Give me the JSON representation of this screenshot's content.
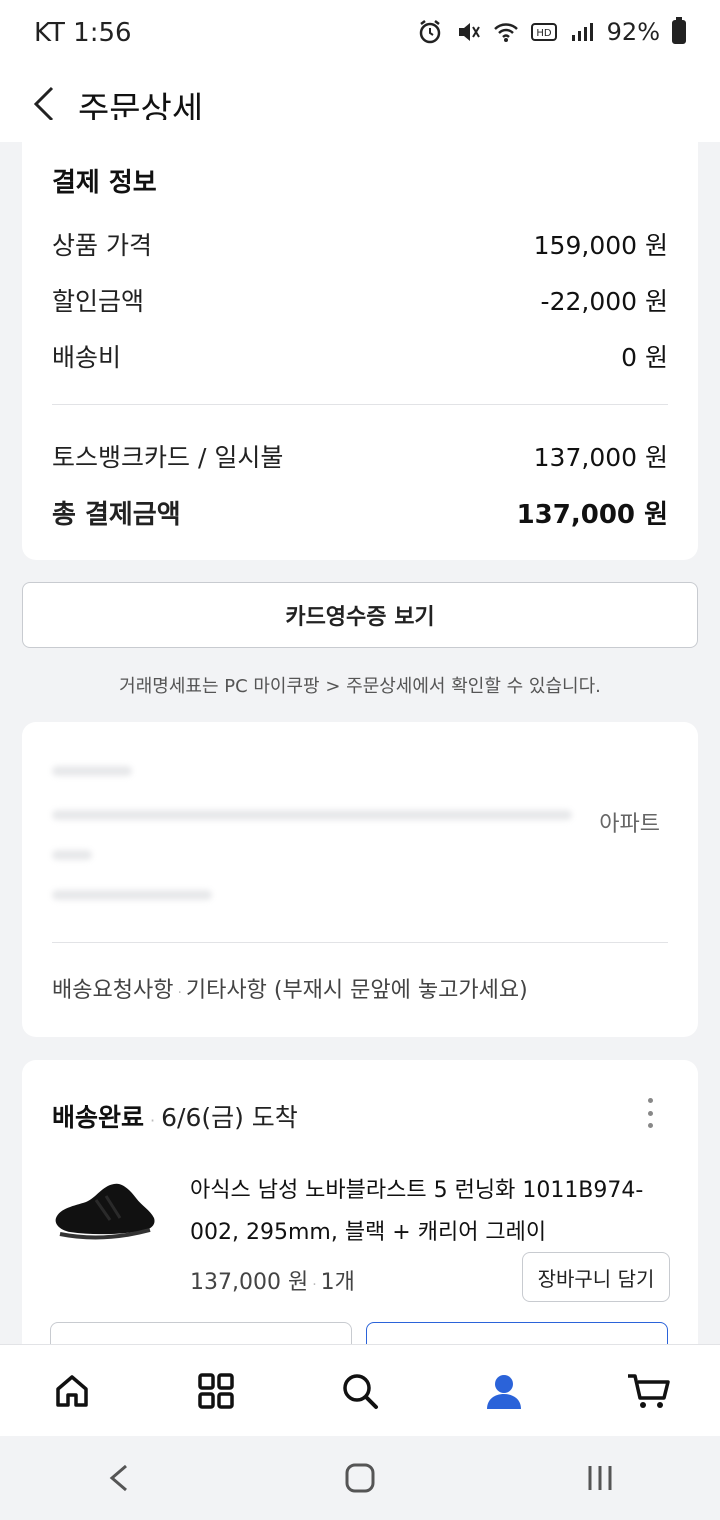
{
  "status_bar": {
    "carrier_time": "KT 1:56",
    "battery": "92%"
  },
  "header": {
    "title": "주문상세"
  },
  "payment": {
    "section_title": "결제 정보",
    "rows": [
      {
        "label": "상품 가격",
        "value": "159,000 원"
      },
      {
        "label": "할인금액",
        "value": "-22,000 원"
      },
      {
        "label": "배송비",
        "value": "0 원"
      }
    ],
    "method": {
      "label": "토스뱅크카드 / 일시불",
      "value": "137,000 원"
    },
    "total": {
      "label": "총 결제금액",
      "value": "137,000 원"
    }
  },
  "receipt_button": "카드영수증 보기",
  "notice": "거래명세표는 PC 마이쿠팡 > 주문상세에서 확인할 수 있습니다.",
  "address": {
    "tail_text": "아파트",
    "request_label": "배송요청사항",
    "request_value": "기타사항 (부재시 문앞에 놓고가세요)"
  },
  "delivery": {
    "status": "배송완료",
    "arrival": "6/6(금) 도착",
    "product_name": "아식스 남성 노바블라스트 5 런닝화 1011B974-002, 295mm, 블랙 + 캐리어 그레이",
    "price": "137,000 원",
    "quantity": "1개",
    "cart_button": "장바구니 담기"
  },
  "nav": {
    "items": [
      "home-icon",
      "category-icon",
      "search-icon",
      "my-coupang-icon",
      "cart-icon"
    ],
    "active": "my-coupang-icon",
    "active_color": "#2b63d9"
  }
}
